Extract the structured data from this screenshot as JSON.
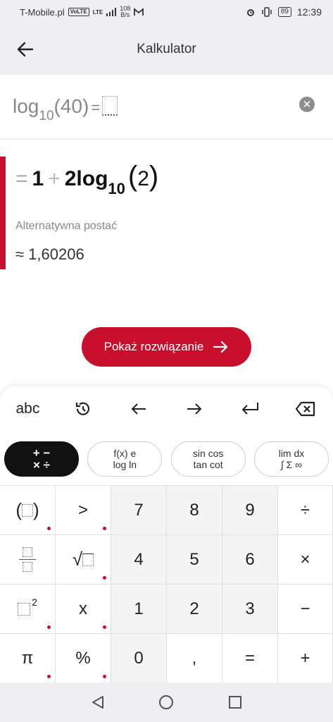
{
  "status_bar": {
    "carrier": "T-Mobile.pl",
    "volte": "VoLTE",
    "network": "LTE",
    "speed_value": "108",
    "speed_unit": "B/s",
    "battery": "89",
    "time": "12:39"
  },
  "app_bar": {
    "title": "Kalkulator"
  },
  "input": {
    "func": "log",
    "base": "10",
    "arg": "(40)",
    "equals": "="
  },
  "result": {
    "eq": "=",
    "one": "1",
    "plus": "+",
    "coef": "2log",
    "base": "10",
    "open_paren": "(",
    "arg": "2",
    "close_paren": ")",
    "alt_label": "Alternatywna postać",
    "approx": "≈ 1,60206"
  },
  "solve_button": {
    "label": "Pokaż rozwiązanie"
  },
  "keyboard": {
    "tools": {
      "abc": "abc"
    },
    "tabs": [
      {
        "line1": "+ −",
        "line2": "× ÷"
      },
      {
        "line1": "f(x)  e",
        "line2": "log  ln"
      },
      {
        "line1": "sin cos",
        "line2": "tan cot"
      },
      {
        "line1": "lim  dx",
        "line2": "∫ Σ ∞"
      }
    ],
    "keys": {
      "gt": ">",
      "seven": "7",
      "eight": "8",
      "nine": "9",
      "divide": "÷",
      "four": "4",
      "five": "5",
      "six": "6",
      "times": "×",
      "x": "x",
      "one": "1",
      "two": "2",
      "three": "3",
      "minus": "−",
      "pi": "π",
      "percent": "%",
      "zero": "0",
      "comma": ",",
      "equals": "=",
      "plus": "+"
    }
  },
  "colors": {
    "accent": "#c8102e",
    "surface": "#efeff1"
  }
}
